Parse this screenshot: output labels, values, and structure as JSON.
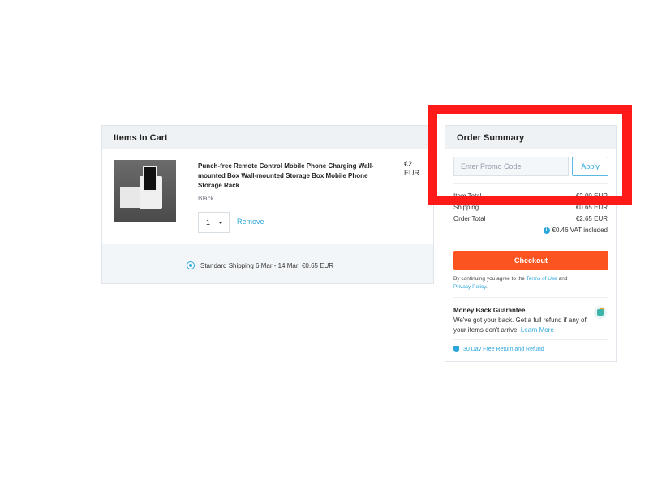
{
  "cart": {
    "header": "Items In Cart",
    "item": {
      "title": "Punch-free Remote Control Mobile Phone Charging Wall-mounted Box Wall-mounted Storage Box Mobile Phone Storage Rack",
      "variant": "Black",
      "price": "€2",
      "currency": "EUR",
      "quantity": "1",
      "remove_label": "Remove"
    },
    "shipping": {
      "label": "Standard Shipping 6 Mar - 14 Mar: €0.65 EUR",
      "selected": true
    }
  },
  "summary": {
    "header": "Order Summary",
    "promo_placeholder": "Enter Promo Code",
    "apply_label": "Apply",
    "rows": [
      {
        "label": "Item Total",
        "value": "€2.00 EUR"
      },
      {
        "label": "Shipping",
        "value": "€0.65 EUR"
      },
      {
        "label": "Order Total",
        "value": "€2.65 EUR"
      }
    ],
    "vat": "€0.46 VAT included",
    "checkout_label": "Checkout",
    "terms_prefix": "By continuing you agree to the",
    "terms_link": "Terms of Use",
    "terms_and": "and",
    "privacy_link": "Privacy Policy",
    "guarantee_title": "Money Back Guarantee",
    "guarantee_text": "We've got your back. Get a full refund if any of your items don't arrive.",
    "learn_more": "Learn More",
    "returns": "30 Day Free Return and Refund"
  },
  "colors": {
    "accent": "#2aa6dc",
    "checkout": "#fc5420",
    "highlight_box": "#ff1a1a"
  }
}
